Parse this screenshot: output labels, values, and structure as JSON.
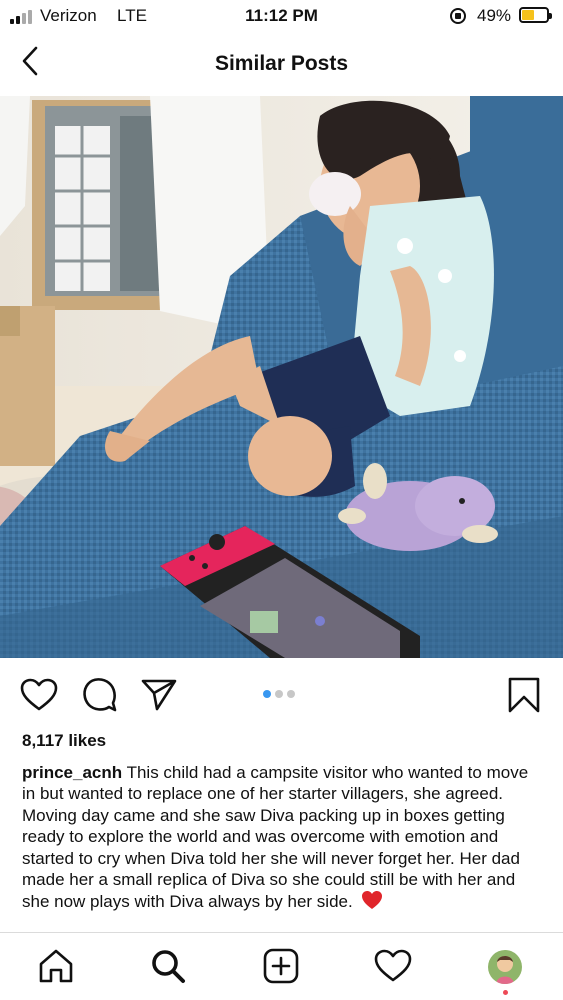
{
  "status_bar": {
    "carrier": "Verizon",
    "network": "LTE",
    "time": "11:12 PM",
    "battery_percent": "49%",
    "battery_level": 0.49,
    "battery_color": "#f6c21b",
    "icons": [
      "signal-icon",
      "rotation-lock-icon",
      "battery-icon"
    ]
  },
  "header": {
    "title": "Similar Posts",
    "back_icon": "chevron-left-icon"
  },
  "post": {
    "photo_description_icon": "photo",
    "carousel": {
      "count": 3,
      "active": 0,
      "active_color": "#3897f0"
    },
    "actions": [
      "heart-icon",
      "comment-icon",
      "share-icon",
      "bookmark-icon"
    ],
    "likes": "8,117 likes",
    "username": "prince_acnh",
    "caption": "This child had a campsite visitor who wanted to move in but wanted to replace one of her starter villagers, she agreed. Moving day came and she saw Diva packing up in boxes getting ready to explore the world and was overcome with emotion and started to cry when Diva told her she will never forget her. Her dad made her a small replica of Diva so she could still be with her and she now plays with Diva always by her side.",
    "emoji": "❤️"
  },
  "tab_bar": {
    "tabs": [
      "home-icon",
      "search-icon",
      "new-post-icon",
      "activity-icon",
      "profile-avatar"
    ],
    "notification_color": "#ed4956"
  }
}
